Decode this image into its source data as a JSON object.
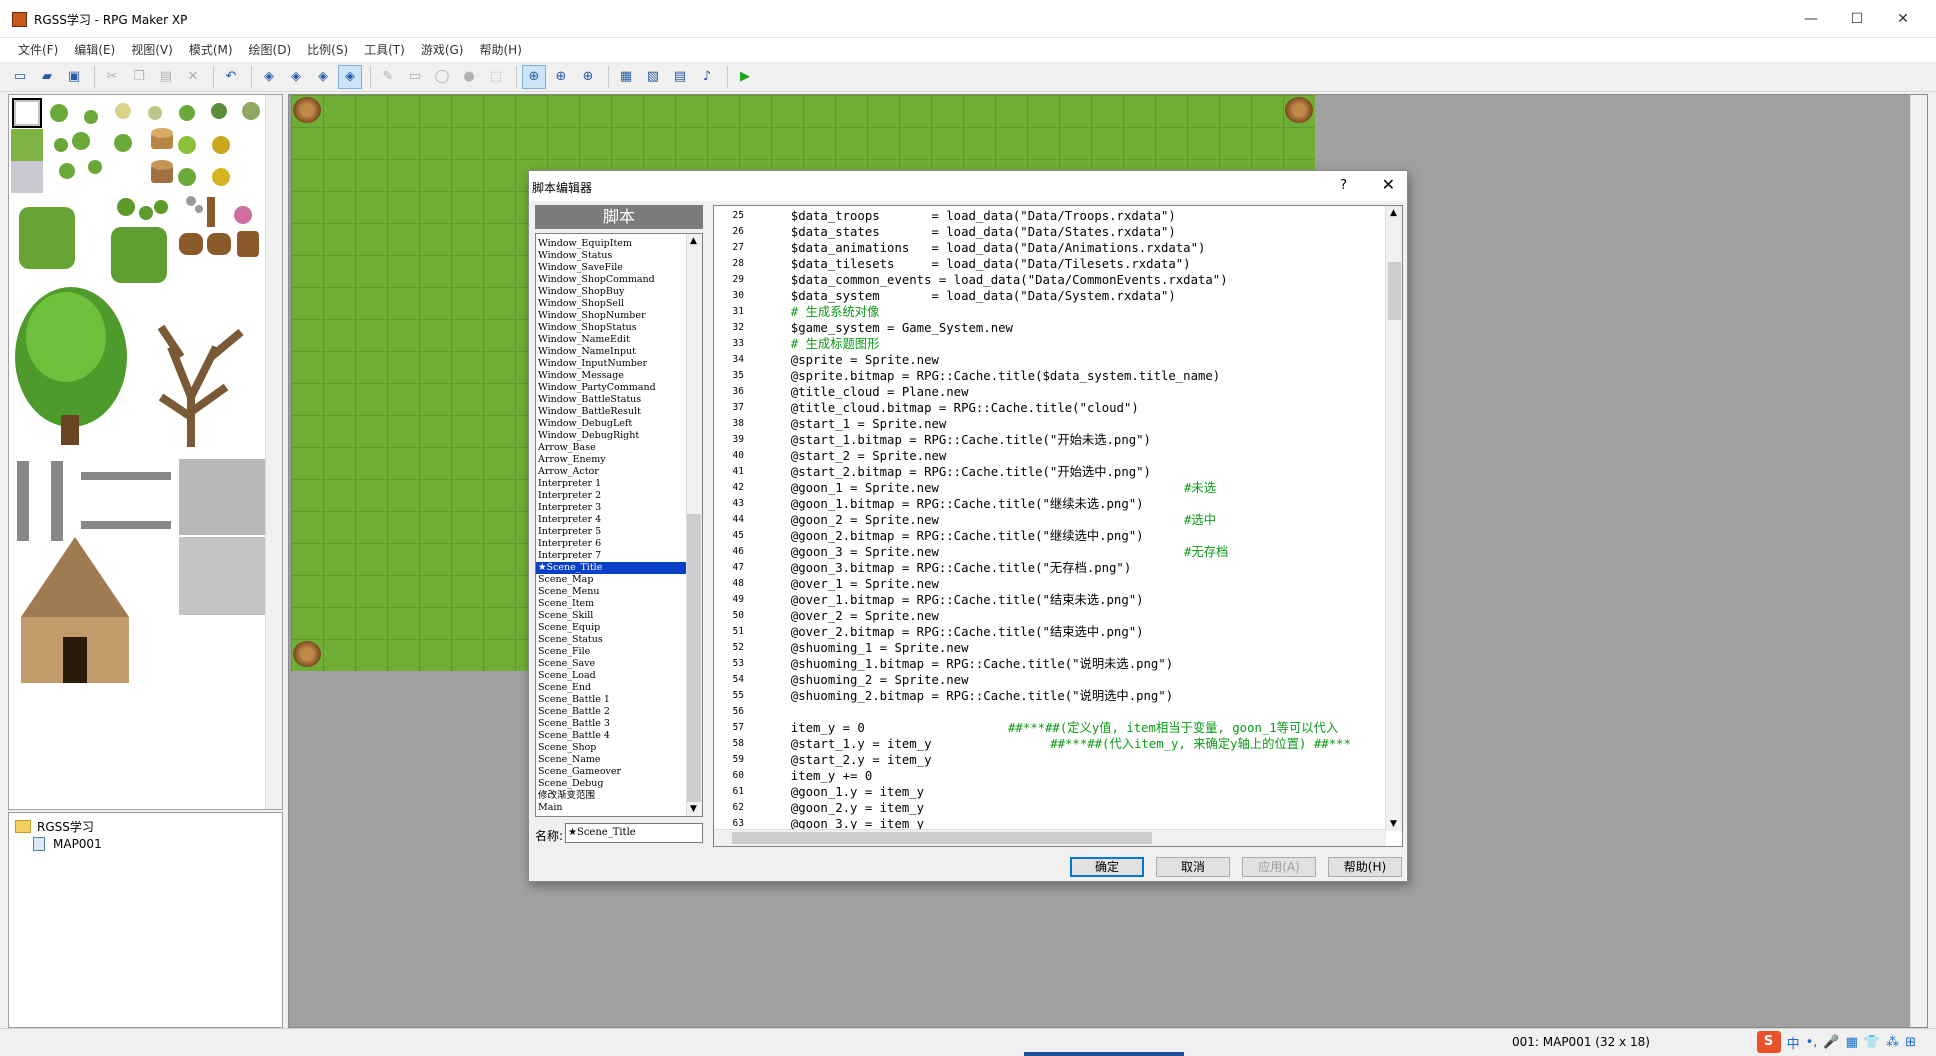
{
  "window": {
    "title": "RGSS学习 - RPG Maker XP",
    "minimize": "—",
    "maximize": "☐",
    "close": "✕"
  },
  "menu": [
    "文件(F)",
    "编辑(E)",
    "视图(V)",
    "模式(M)",
    "绘图(D)",
    "比例(S)",
    "工具(T)",
    "游戏(G)",
    "帮助(H)"
  ],
  "toolbar": [
    {
      "name": "new-project-icon",
      "glyph": "▭",
      "state": "normal"
    },
    {
      "name": "open-project-icon",
      "glyph": "▰",
      "state": "normal"
    },
    {
      "name": "save-project-icon",
      "glyph": "▣",
      "state": "normal"
    },
    {
      "sep": true
    },
    {
      "name": "cut-icon",
      "glyph": "✂",
      "state": "dis"
    },
    {
      "name": "copy-icon",
      "glyph": "❐",
      "state": "dis"
    },
    {
      "name": "paste-icon",
      "glyph": "▤",
      "state": "dis"
    },
    {
      "name": "delete-icon",
      "glyph": "✕",
      "state": "dis"
    },
    {
      "sep": true
    },
    {
      "name": "undo-icon",
      "glyph": "↶",
      "state": "normal"
    },
    {
      "sep": true
    },
    {
      "name": "layer1-icon",
      "glyph": "◈",
      "state": "normal"
    },
    {
      "name": "layer2-icon",
      "glyph": "◈",
      "state": "normal"
    },
    {
      "name": "layer3-icon",
      "glyph": "◈",
      "state": "normal"
    },
    {
      "name": "event-layer-icon",
      "glyph": "◈",
      "state": "sel"
    },
    {
      "sep": true
    },
    {
      "name": "pencil-icon",
      "glyph": "✎",
      "state": "dis"
    },
    {
      "name": "rectangle-icon",
      "glyph": "▭",
      "state": "dis"
    },
    {
      "name": "ellipse-icon",
      "glyph": "◯",
      "state": "dis"
    },
    {
      "name": "fill-icon",
      "glyph": "●",
      "state": "dis"
    },
    {
      "name": "select-icon",
      "glyph": "⬚",
      "state": "dis"
    },
    {
      "sep": true
    },
    {
      "name": "zoom-1-1-icon",
      "glyph": "⊕",
      "state": "sel"
    },
    {
      "name": "zoom-1-2-icon",
      "glyph": "⊕",
      "state": "normal"
    },
    {
      "name": "zoom-1-4-icon",
      "glyph": "⊕",
      "state": "normal"
    },
    {
      "sep": true
    },
    {
      "name": "database-icon",
      "glyph": "▦",
      "state": "normal"
    },
    {
      "name": "material-icon",
      "glyph": "▧",
      "state": "normal"
    },
    {
      "name": "script-editor-icon",
      "glyph": "▤",
      "state": "normal"
    },
    {
      "name": "sound-test-icon",
      "glyph": "♪",
      "state": "normal"
    },
    {
      "sep": true
    },
    {
      "name": "playtest-icon",
      "glyph": "▶",
      "state": "play"
    }
  ],
  "maptree": {
    "root": "RGSS学习",
    "map": "MAP001"
  },
  "status": {
    "map_info": "001: MAP001 (32 x 18)"
  },
  "ime": {
    "logo": "S",
    "items": [
      "中",
      "•,",
      "🎤",
      "▦",
      "👕",
      "⁂",
      "⊞"
    ]
  },
  "dialog": {
    "title": "脚本编辑器",
    "help": "?",
    "close": "✕",
    "list_header": "脚本",
    "name_label": "名称:",
    "name_value": "★Scene_Title",
    "buttons": {
      "ok": "确定",
      "cancel": "取消",
      "apply": "应用(A)",
      "help": "帮助(H)"
    },
    "scripts": [
      "Window_EquipItem",
      "Window_Status",
      "Window_SaveFile",
      "Window_ShopCommand",
      "Window_ShopBuy",
      "Window_ShopSell",
      "Window_ShopNumber",
      "Window_ShopStatus",
      "Window_NameEdit",
      "Window_NameInput",
      "Window_InputNumber",
      "Window_Message",
      "Window_PartyCommand",
      "Window_BattleStatus",
      "Window_BattleResult",
      "Window_DebugLeft",
      "Window_DebugRight",
      "Arrow_Base",
      "Arrow_Enemy",
      "Arrow_Actor",
      "Interpreter 1",
      "Interpreter 2",
      "Interpreter 3",
      "Interpreter 4",
      "Interpreter 5",
      "Interpreter 6",
      "Interpreter 7",
      "★Scene_Title",
      "Scene_Map",
      "Scene_Menu",
      "Scene_Item",
      "Scene_Skill",
      "Scene_Equip",
      "Scene_Status",
      "Scene_File",
      "Scene_Save",
      "Scene_Load",
      "Scene_End",
      "Scene_Battle 1",
      "Scene_Battle 2",
      "Scene_Battle 3",
      "Scene_Battle 4",
      "Scene_Shop",
      "Scene_Name",
      "Scene_Gameover",
      "Scene_Debug",
      "修改渐变范围",
      "Main"
    ],
    "selected_index": 27,
    "code": [
      {
        "n": "25",
        "t": "  $data_troops       = load_data(\"Data/Troops.rxdata\")"
      },
      {
        "n": "26",
        "t": "  $data_states       = load_data(\"Data/States.rxdata\")"
      },
      {
        "n": "27",
        "t": "  $data_animations   = load_data(\"Data/Animations.rxdata\")"
      },
      {
        "n": "28",
        "t": "  $data_tilesets     = load_data(\"Data/Tilesets.rxdata\")"
      },
      {
        "n": "29",
        "t": "  $data_common_events = load_data(\"Data/CommonEvents.rxdata\")"
      },
      {
        "n": "30",
        "t": "  $data_system       = load_data(\"Data/System.rxdata\")"
      },
      {
        "n": "31",
        "t": "  # 生成系统对像",
        "cm": true
      },
      {
        "n": "32",
        "t": "  $game_system = Game_System.new"
      },
      {
        "n": "33",
        "t": "  # 生成标题图形",
        "cm": true
      },
      {
        "n": "34",
        "t": "  @sprite = Sprite.new"
      },
      {
        "n": "35",
        "t": "  @sprite.bitmap = RPG::Cache.title($data_system.title_name)"
      },
      {
        "n": "36",
        "t": "  @title_cloud = Plane.new"
      },
      {
        "n": "37",
        "t": "  @title_cloud.bitmap = RPG::Cache.title(\"cloud\")"
      },
      {
        "n": "38",
        "t": "  @start_1 = Sprite.new"
      },
      {
        "n": "39",
        "t": "  @start_1.bitmap = RPG::Cache.title(\"开始未选.png\")"
      },
      {
        "n": "40",
        "t": "  @start_2 = Sprite.new"
      },
      {
        "n": "41",
        "t": "  @start_2.bitmap = RPG::Cache.title(\"开始选中.png\")"
      },
      {
        "n": "42",
        "t": "  @goon_1 = Sprite.new",
        "a": "#未选"
      },
      {
        "n": "43",
        "t": "  @goon_1.bitmap = RPG::Cache.title(\"继续未选.png\")"
      },
      {
        "n": "44",
        "t": "  @goon_2 = Sprite.new",
        "a": "#选中"
      },
      {
        "n": "45",
        "t": "  @goon_2.bitmap = RPG::Cache.title(\"继续选中.png\")"
      },
      {
        "n": "46",
        "t": "  @goon_3 = Sprite.new",
        "a": "#无存档"
      },
      {
        "n": "47",
        "t": "  @goon_3.bitmap = RPG::Cache.title(\"无存档.png\")"
      },
      {
        "n": "48",
        "t": "  @over_1 = Sprite.new"
      },
      {
        "n": "49",
        "t": "  @over_1.bitmap = RPG::Cache.title(\"结束未选.png\")"
      },
      {
        "n": "50",
        "t": "  @over_2 = Sprite.new"
      },
      {
        "n": "51",
        "t": "  @over_2.bitmap = RPG::Cache.title(\"结束选中.png\")"
      },
      {
        "n": "52",
        "t": "  @shuoming_1 = Sprite.new"
      },
      {
        "n": "53",
        "t": "  @shuoming_1.bitmap = RPG::Cache.title(\"说明未选.png\")"
      },
      {
        "n": "54",
        "t": "  @shuoming_2 = Sprite.new"
      },
      {
        "n": "55",
        "t": "  @shuoming_2.bitmap = RPG::Cache.title(\"说明选中.png\")"
      },
      {
        "n": "56",
        "t": ""
      },
      {
        "n": "57",
        "t": "  item_y = 0",
        "a": "##***##(定义y值, item相当于变量, goon_1等可以代入"
      },
      {
        "n": "58",
        "t": "  @start_1.y = item_y",
        "a": "   ##***##(代入item_y, 来确定y轴上的位置) ##***"
      },
      {
        "n": "59",
        "t": "  @start_2.y = item_y"
      },
      {
        "n": "60",
        "t": "  item_y += 0"
      },
      {
        "n": "61",
        "t": "  @goon_1.y = item_y"
      },
      {
        "n": "62",
        "t": "  @goon_2.y = item_y"
      },
      {
        "n": "63",
        "t": "  @goon_3.y = item_y"
      }
    ]
  }
}
